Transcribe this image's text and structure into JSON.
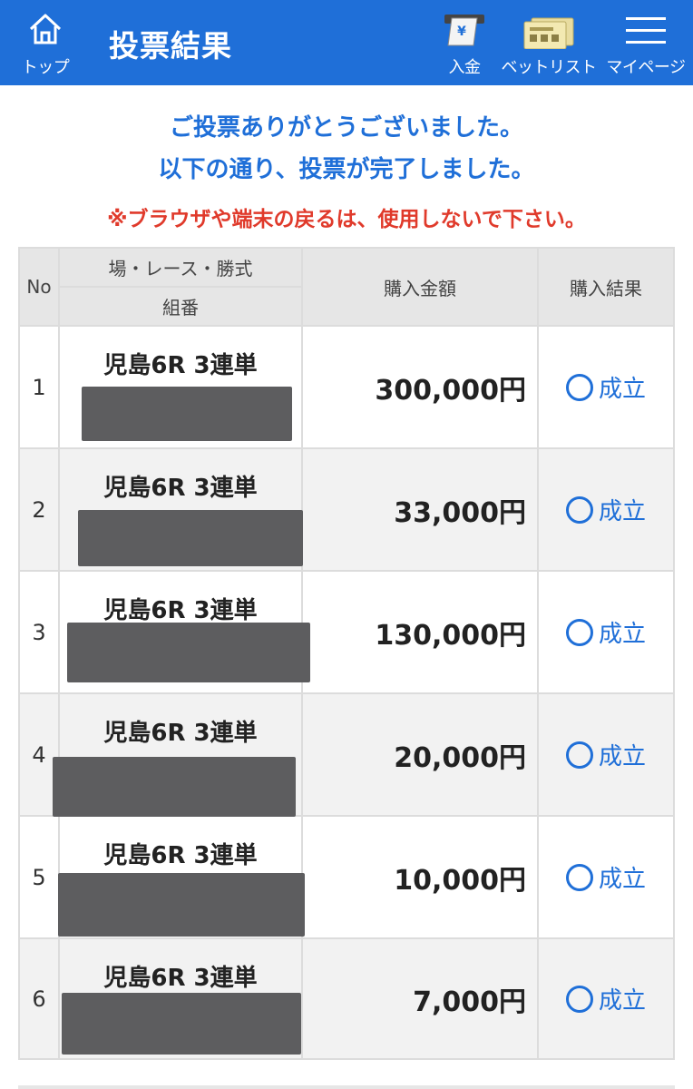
{
  "header": {
    "home_label": "トップ",
    "title": "投票結果",
    "deposit_label": "入金",
    "betlist_label": "ベットリスト",
    "mypage_label": "マイページ",
    "deposit_icon": "yen-ticket-icon",
    "betlist_icon": "ticket-list-icon",
    "mypage_icon": "hamburger-menu-icon",
    "home_icon": "home-icon",
    "bg_color": "#1f6fd8"
  },
  "messages": {
    "thanks": "ご投票ありがとうございました。",
    "complete": "以下の通り、投票が完了しました。",
    "warning": "※ブラウザや端末の戻るは、使用しないで下さい。",
    "accent_color": "#1f6fd8",
    "warning_color": "#e03a2b"
  },
  "table": {
    "headers": {
      "no": "No",
      "race_top": "場・レース・勝式",
      "race_bottom": "組番",
      "amount": "購入金額",
      "result": "購入結果"
    },
    "rows": [
      {
        "no": "1",
        "race": "児島6R 3連単",
        "amount": "300,000円",
        "result": "成立"
      },
      {
        "no": "2",
        "race": "児島6R 3連単",
        "amount": "33,000円",
        "result": "成立"
      },
      {
        "no": "3",
        "race": "児島6R 3連単",
        "amount": "130,000円",
        "result": "成立"
      },
      {
        "no": "4",
        "race": "児島6R 3連単",
        "amount": "20,000円",
        "result": "成立"
      },
      {
        "no": "5",
        "race": "児島6R 3連単",
        "amount": "10,000円",
        "result": "成立"
      },
      {
        "no": "6",
        "race": "児島6R 3連単",
        "amount": "7,000円",
        "result": "成立"
      }
    ]
  }
}
